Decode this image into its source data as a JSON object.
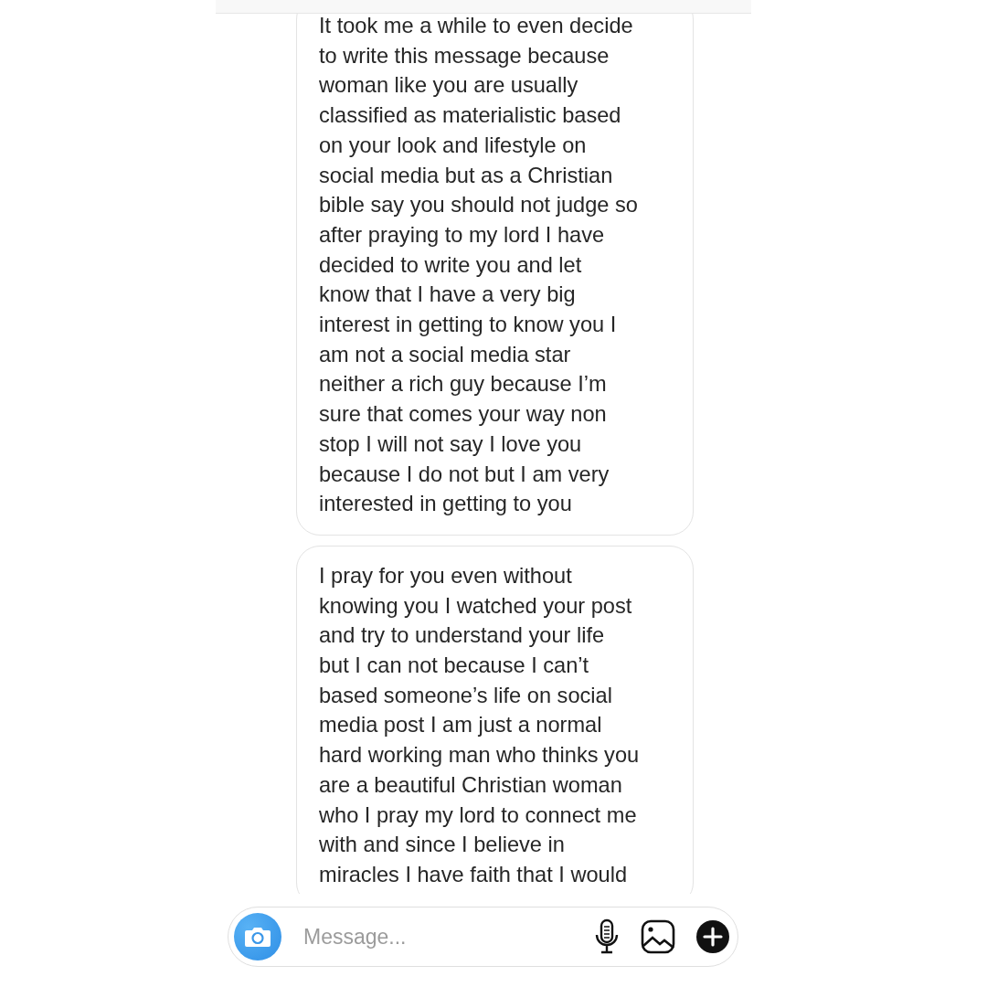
{
  "messages": [
    {
      "text": "It took me a while to even decide\nto write this message because\nwoman like you are usually\nclassified as materialistic based\non your look and lifestyle on\nsocial media but as a Christian\nbible say you should not judge so\nafter praying to my lord I have\ndecided to write you and let\nknow that I have a very big\ninterest in getting to know you I\nam not a social media star\nneither a rich guy because I’m\nsure that comes your way non\nstop I will not say I love you\nbecause I do not but I am very\ninterested in getting to you"
    },
    {
      "text": "I pray for you even without\nknowing you I watched your post\nand try to understand your life\nbut I can not because I can’t\nbased someone’s life on social\nmedia post I am just a normal\nhard working man who thinks you\nare a beautiful Christian woman\nwho I pray my lord to connect me\nwith and since I believe in\nmiracles I have faith that I would"
    }
  ],
  "composer": {
    "placeholder": "Message..."
  }
}
